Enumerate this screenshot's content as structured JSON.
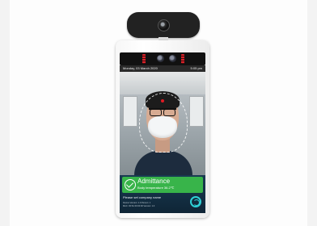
{
  "statusbar": {
    "date": "Monday, 03 March 2020",
    "time": "5:05 pm"
  },
  "result": {
    "status": "Admittance",
    "temperature": "Body temperature 36.2℃",
    "company": "Please set company name",
    "info_line_1": "Device Version:  1.0   Person: 1",
    "info_line_2": "MAC: 00:5A:00:00:00   Version: 1.0"
  },
  "colors": {
    "admit_green": "#38b44a",
    "panel_navy": "#193a52",
    "logo_cyan": "#2fd0d6",
    "target_red": "#e01b24"
  },
  "icons": [
    "camera-lens-icon",
    "ir-sensor-icon",
    "check-circle-icon",
    "brand-logo-icon"
  ]
}
